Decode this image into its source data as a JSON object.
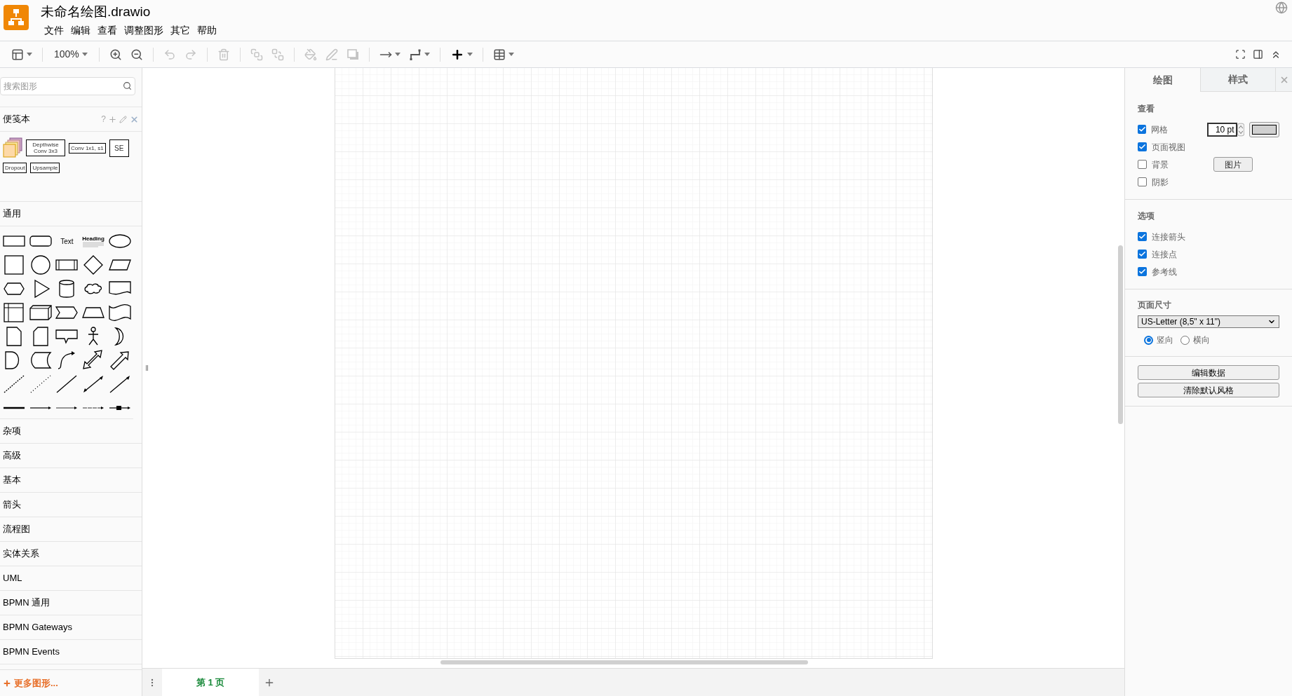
{
  "app": {
    "title": "未命名绘图.drawio"
  },
  "menu": [
    "文件",
    "编辑",
    "查看",
    "调整图形",
    "其它",
    "帮助"
  ],
  "toolbar": {
    "tools": [
      {
        "kind": "layout",
        "menu": true,
        "disabled": false
      },
      {
        "kind": "separator"
      },
      {
        "kind": "zoom",
        "label": "100%",
        "menu": true,
        "disabled": false
      },
      {
        "kind": "separator"
      },
      {
        "kind": "zoom-in",
        "menu": false,
        "disabled": false
      },
      {
        "kind": "zoom-out",
        "menu": false,
        "disabled": false
      },
      {
        "kind": "separator"
      },
      {
        "kind": "undo",
        "menu": false,
        "disabled": true
      },
      {
        "kind": "redo",
        "menu": false,
        "disabled": true
      },
      {
        "kind": "separator"
      },
      {
        "kind": "delete",
        "menu": false,
        "disabled": true
      },
      {
        "kind": "separator"
      },
      {
        "kind": "to-front",
        "menu": false,
        "disabled": true
      },
      {
        "kind": "to-back",
        "menu": false,
        "disabled": true
      },
      {
        "kind": "separator"
      },
      {
        "kind": "fill",
        "menu": false,
        "disabled": true
      },
      {
        "kind": "line",
        "menu": false,
        "disabled": true
      },
      {
        "kind": "shadow",
        "menu": false,
        "disabled": true
      },
      {
        "kind": "separator"
      },
      {
        "kind": "connection",
        "menu": true,
        "disabled": false
      },
      {
        "kind": "waypoints",
        "menu": true,
        "disabled": false
      },
      {
        "kind": "separator"
      },
      {
        "kind": "insert",
        "menu": true,
        "disabled": false
      },
      {
        "kind": "separator"
      },
      {
        "kind": "table",
        "menu": true,
        "disabled": false
      }
    ]
  },
  "sidebar": {
    "search": {
      "placeholder": "搜索图形"
    },
    "scratchpad": {
      "title": "便笺本",
      "help": "?",
      "items": [
        {
          "kind": "stack"
        },
        {
          "kind": "box",
          "label": "Depthwise Conv 3x3"
        },
        {
          "kind": "box",
          "label": "Conv 1x1, s1"
        },
        {
          "kind": "big-box",
          "label": "SE"
        },
        {
          "kind": "box",
          "label": "Dropout"
        },
        {
          "kind": "box",
          "label": "Upsample"
        }
      ]
    },
    "general": {
      "title": "通用",
      "text_shape": "Text",
      "heading_shape": "Heading"
    },
    "categories": [
      "杂项",
      "高级",
      "基本",
      "箭头",
      "流程图",
      "实体关系",
      "UML",
      "BPMN 通用",
      "BPMN Gateways",
      "BPMN Events"
    ],
    "more_shapes": "更多图形..."
  },
  "pages": [
    {
      "label": "第 1 页",
      "selected": true
    }
  ],
  "format_panel": {
    "tabs": [
      {
        "label": "绘图",
        "selected": true
      },
      {
        "label": "样式",
        "selected": false
      }
    ],
    "view": {
      "title": "查看",
      "options": [
        {
          "label": "网格",
          "checked": true
        },
        {
          "label": "页面视图",
          "checked": true
        },
        {
          "label": "背景",
          "checked": false
        },
        {
          "label": "阴影",
          "checked": false
        }
      ],
      "grid_size": "10 pt",
      "image_button": "图片"
    },
    "options": {
      "title": "选项",
      "items": [
        {
          "label": "连接箭头",
          "checked": true
        },
        {
          "label": "连接点",
          "checked": true
        },
        {
          "label": "参考线",
          "checked": true
        }
      ]
    },
    "page_size": {
      "title": "页面尺寸",
      "value": "US-Letter (8,5\" x 11\")",
      "orientations": [
        {
          "label": "竖向",
          "selected": true
        },
        {
          "label": "横向",
          "selected": false
        }
      ]
    },
    "buttons": [
      "编辑数据",
      "清除默认风格"
    ]
  }
}
